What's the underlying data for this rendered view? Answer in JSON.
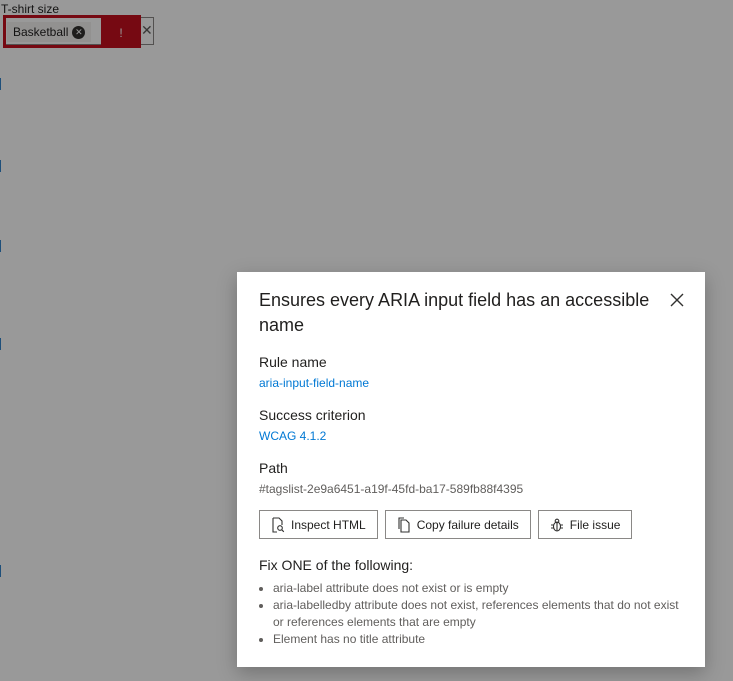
{
  "background_form": {
    "field_label": "T-shirt size",
    "tag_label": "Basketball",
    "highlight_badge": "!"
  },
  "dialog": {
    "title": "Ensures every ARIA input field has an accessible name",
    "rule_name_label": "Rule name",
    "rule_name_value": "aria-input-field-name",
    "success_criterion_label": "Success criterion",
    "success_criterion_value": "WCAG 4.1.2",
    "path_label": "Path",
    "path_value": "#tagslist-2e9a6451-a19f-45fd-ba17-589fb88f4395",
    "buttons": {
      "inspect": "Inspect HTML",
      "copy": "Copy failure details",
      "file_issue": "File issue"
    },
    "fix_heading": "Fix ONE of the following:",
    "fix_items": [
      "aria-label attribute does not exist or is empty",
      "aria-labelledby attribute does not exist, references elements that do not exist or references elements that are empty",
      "Element has no title attribute"
    ]
  },
  "colors": {
    "link": "#0078d4",
    "error": "#c50f1f",
    "overlay": "rgba(0,0,0,0.4)"
  },
  "icons": {
    "tag_remove": "circle-x-icon",
    "clear": "x-icon",
    "close": "close-icon",
    "inspect": "file-search-icon",
    "copy": "copy-icon",
    "file_issue": "bug-icon"
  }
}
